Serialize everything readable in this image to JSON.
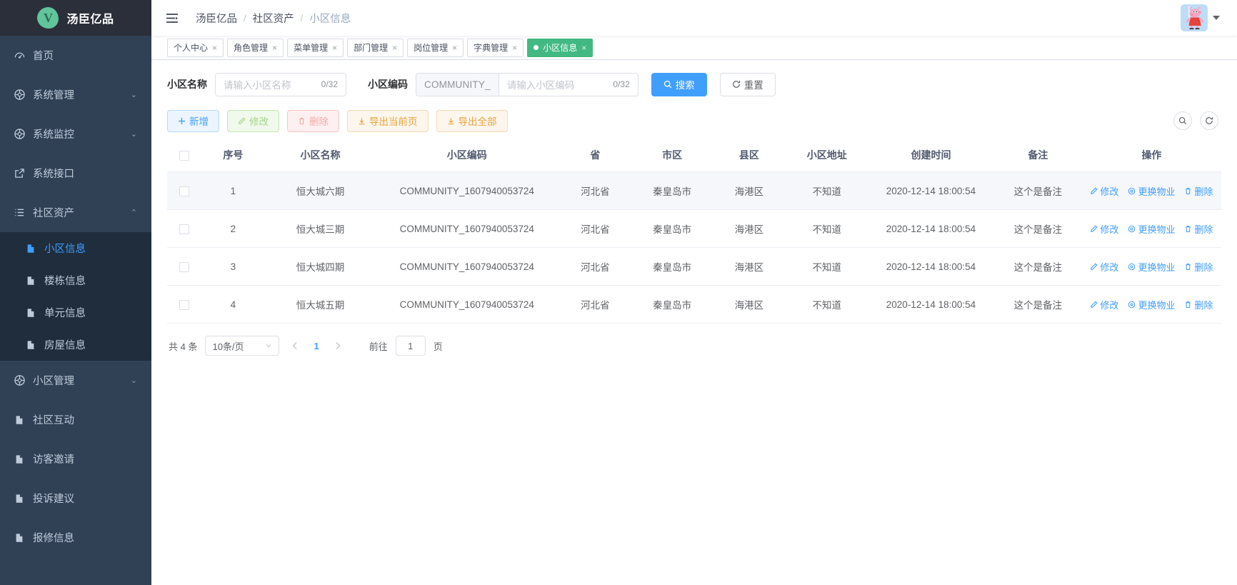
{
  "brand": {
    "name": "汤臣亿品",
    "logo_letter": "V",
    "logo_color": "#61c49a"
  },
  "sidebar": {
    "items": [
      {
        "label": "首页",
        "icon": "dashboard-icon",
        "arrow": "",
        "active": false
      },
      {
        "label": "系统管理",
        "icon": "gear-icon",
        "arrow": "⌄",
        "active": false
      },
      {
        "label": "系统监控",
        "icon": "gear-icon",
        "arrow": "⌄",
        "active": false
      },
      {
        "label": "系统接口",
        "icon": "external-link-icon",
        "arrow": "",
        "active": false
      },
      {
        "label": "社区资产",
        "icon": "list-icon",
        "arrow": "⌃",
        "active": true
      }
    ],
    "submenu": [
      {
        "label": "小区信息",
        "icon": "document-icon",
        "active": true
      },
      {
        "label": "楼栋信息",
        "icon": "document-icon",
        "active": false
      },
      {
        "label": "单元信息",
        "icon": "document-icon",
        "active": false
      },
      {
        "label": "房屋信息",
        "icon": "document-icon",
        "active": false
      }
    ],
    "items_after": [
      {
        "label": "小区管理",
        "icon": "gear-icon",
        "arrow": "⌄"
      },
      {
        "label": "社区互动",
        "icon": "document-icon",
        "arrow": ""
      },
      {
        "label": "访客邀请",
        "icon": "document-icon",
        "arrow": ""
      },
      {
        "label": "投诉建议",
        "icon": "document-icon",
        "arrow": ""
      },
      {
        "label": "报修信息",
        "icon": "document-icon",
        "arrow": ""
      }
    ]
  },
  "navbar": {
    "hamburger_icon": "hamburger-icon",
    "breadcrumb": [
      "汤臣亿品",
      "社区资产",
      "小区信息"
    ],
    "separator": "/",
    "avatar_icon": "user-avatar",
    "caret_icon": "caret-down-icon"
  },
  "tags": [
    {
      "label": "个人中心",
      "active": false
    },
    {
      "label": "角色管理",
      "active": false
    },
    {
      "label": "菜单管理",
      "active": false
    },
    {
      "label": "部门管理",
      "active": false
    },
    {
      "label": "岗位管理",
      "active": false
    },
    {
      "label": "字典管理",
      "active": false
    },
    {
      "label": "小区信息",
      "active": true
    }
  ],
  "tag_close": "×",
  "filter": {
    "name_label": "小区名称",
    "name_placeholder": "请输入小区名称",
    "name_value": "",
    "name_counter": "0/32",
    "code_label": "小区编码",
    "code_prefix": "COMMUNITY_",
    "code_placeholder": "请输入小区编码",
    "code_value": "",
    "code_counter": "0/32",
    "search_label": "搜索",
    "search_icon": "search-icon",
    "reset_label": "重置",
    "reset_icon": "refresh-icon"
  },
  "actions": [
    {
      "label": "新增",
      "icon": "plus-icon",
      "style": "plain-blue"
    },
    {
      "label": "修改",
      "icon": "edit-icon",
      "style": "plain-green"
    },
    {
      "label": "删除",
      "icon": "trash-icon",
      "style": "plain-red"
    },
    {
      "label": "导出当前页",
      "icon": "download-icon",
      "style": "plain-warn"
    },
    {
      "label": "导出全部",
      "icon": "download-icon",
      "style": "plain-warn"
    }
  ],
  "tools": [
    {
      "name": "search-tool-icon"
    },
    {
      "name": "refresh-tool-icon"
    }
  ],
  "table": {
    "columns": [
      "",
      "序号",
      "小区名称",
      "小区编码",
      "省",
      "市区",
      "县区",
      "小区地址",
      "创建时间",
      "备注",
      "操作"
    ],
    "rows": [
      {
        "index": "1",
        "name": "恒大城六期",
        "code": "COMMUNITY_1607940053724",
        "province": "河北省",
        "city": "秦皇岛市",
        "county": "海港区",
        "address": "不知道",
        "created": "2020-12-14 18:00:54",
        "remark": "这个是备注",
        "hovered": true
      },
      {
        "index": "2",
        "name": "恒大城三期",
        "code": "COMMUNITY_1607940053724",
        "province": "河北省",
        "city": "秦皇岛市",
        "county": "海港区",
        "address": "不知道",
        "created": "2020-12-14 18:00:54",
        "remark": "这个是备注",
        "hovered": false
      },
      {
        "index": "3",
        "name": "恒大城四期",
        "code": "COMMUNITY_1607940053724",
        "province": "河北省",
        "city": "秦皇岛市",
        "county": "海港区",
        "address": "不知道",
        "created": "2020-12-14 18:00:54",
        "remark": "这个是备注",
        "hovered": false
      },
      {
        "index": "4",
        "name": "恒大城五期",
        "code": "COMMUNITY_1607940053724",
        "province": "河北省",
        "city": "秦皇岛市",
        "county": "海港区",
        "address": "不知道",
        "created": "2020-12-14 18:00:54",
        "remark": "这个是备注",
        "hovered": false
      }
    ],
    "row_ops": [
      {
        "label": "修改",
        "icon": "edit-icon"
      },
      {
        "label": "更换物业",
        "icon": "swap-icon"
      },
      {
        "label": "删除",
        "icon": "trash-icon"
      }
    ]
  },
  "pagination": {
    "total_text": "共 4 条",
    "page_size": "10条/页",
    "prev_icon": "chevron-left-icon",
    "next_icon": "chevron-right-icon",
    "current_page": "1",
    "jump_prefix": "前往",
    "jump_value": "1",
    "jump_suffix": "页"
  },
  "colors": {
    "sidebar_bg": "#304156",
    "submenu_bg": "#1f2d3d",
    "accent": "#409eff",
    "tag_active": "#42b983"
  }
}
